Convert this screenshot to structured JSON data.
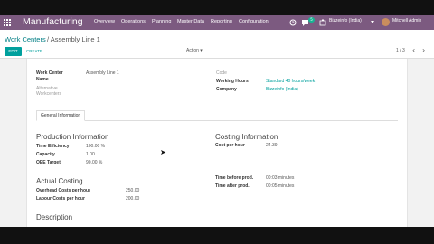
{
  "navbar": {
    "brand": "Manufacturing",
    "menu": [
      "Overview",
      "Operations",
      "Planning",
      "Master Data",
      "Reporting",
      "Configuration"
    ],
    "badge_count": "5",
    "company": "Bizzeinfo (India)",
    "user": "Mitchell Admin"
  },
  "breadcrumb": {
    "parent": "Work Centers",
    "separator": "/",
    "current": "Assembly Line 1"
  },
  "buttons": {
    "edit": "EDIT",
    "create": "CREATE",
    "action": "Action"
  },
  "pager": {
    "text": "1 / 3"
  },
  "form": {
    "work_center_label": "Work Center",
    "name_label": "Name",
    "work_center_value": "Assembly Line 1",
    "alternative_label": "Alternative",
    "workcenters_label": "Workcenters",
    "code_label": "Code",
    "working_hours_label": "Working Hours",
    "working_hours_value": "Standard 40 hours/week",
    "company_label": "Company",
    "company_value": "Bizzeinfo (India)",
    "tab_general": "General Information",
    "production_title": "Production Information",
    "time_efficiency_label": "Time Efficiency",
    "time_efficiency_value": "100.00 %",
    "capacity_label": "Capacity",
    "capacity_value": "1.00",
    "oee_label": "OEE Target",
    "oee_value": "90.00 %",
    "costing_title": "Costing Information",
    "cost_per_hour_label": "Cost per hour",
    "cost_per_hour_value": "24.39",
    "actual_costing_title": "Actual Costing",
    "overhead_label": "Overhead Costs per hour",
    "overhead_value": "250.00",
    "labour_label": "Labour Costs per hour",
    "labour_value": "200.00",
    "time_before_label": "Time before prod.",
    "time_before_value": "00:03 minutes",
    "time_after_label": "Time after prod.",
    "time_after_value": "00:05 minutes",
    "description_title": "Description"
  },
  "colors": {
    "navbar": "#7c5a80",
    "primary": "#00a09d",
    "link": "#017e84"
  }
}
